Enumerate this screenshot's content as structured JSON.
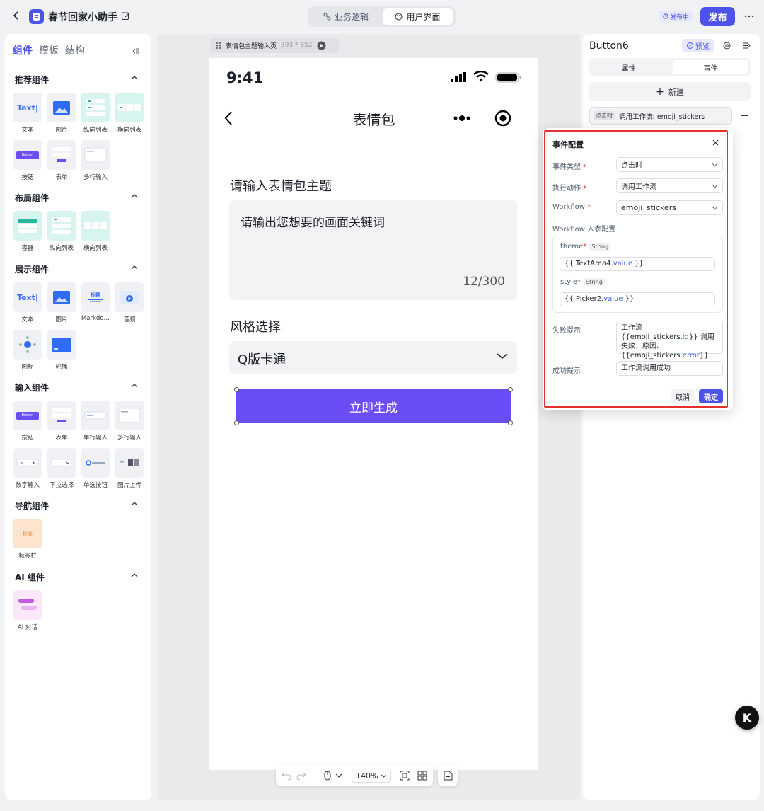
{
  "header": {
    "back_icon": "chevron-left-icon",
    "app_icon": "doc-icon",
    "app_name": "春节回家小助手",
    "edit_icon": "edit-icon",
    "tabs": [
      {
        "label": "业务逻辑",
        "icon": "flow-icon",
        "active": false
      },
      {
        "label": "用户界面",
        "icon": "palette-icon",
        "active": true
      }
    ],
    "publish_status": "发布中",
    "publish_label": "发布",
    "more_icon": "more-icon"
  },
  "left_panel": {
    "tabs": [
      "组件",
      "模板",
      "结构"
    ],
    "active_tab": "组件",
    "sections": [
      {
        "title": "推荐组件",
        "items": [
          "文本",
          "图片",
          "纵向列表",
          "横向列表",
          "按钮",
          "表单",
          "多行输入"
        ]
      },
      {
        "title": "布局组件",
        "items": [
          "容器",
          "纵向列表",
          "横向列表"
        ]
      },
      {
        "title": "展示组件",
        "items": [
          "文本",
          "图片",
          "Markdo…",
          "音频",
          "图标",
          "轮播"
        ]
      },
      {
        "title": "输入组件",
        "items": [
          "按钮",
          "表单",
          "单行输入",
          "多行输入",
          "数字输入",
          "下拉选择",
          "单选按钮",
          "图片上传"
        ]
      },
      {
        "title": "导航组件",
        "items": [
          "标签栏"
        ]
      },
      {
        "title": "AI 组件",
        "items": [
          "AI 对话"
        ]
      }
    ],
    "thumb_text": {
      "text": "Text",
      "button": "Button",
      "markdown": "标题",
      "tab": "标签"
    }
  },
  "canvas": {
    "page_label": "表情包主题输入页",
    "page_size": "393 * 852",
    "phone": {
      "time": "9:41",
      "title": "表情包",
      "theme_label": "请输入表情包主题",
      "theme_placeholder": "请输出您想要的画面关键词",
      "counter": "12/300",
      "style_label": "风格选择",
      "style_value": "Q版卡通",
      "button_label": "立即生成"
    },
    "zoom": "140%"
  },
  "right_panel": {
    "component_name": "Button6",
    "preview_label": "预览",
    "tabs": [
      "属性",
      "事件"
    ],
    "active_tab": "事件",
    "new_label": "新建",
    "event_tag": "点击时",
    "event_desc": "调用工作流: emoji_stickers"
  },
  "popup": {
    "title": "事件配置",
    "event_type_label": "事件类型",
    "event_type_value": "点击时",
    "action_label": "执行动作",
    "action_value": "调用工作流",
    "workflow_label": "Workflow",
    "workflow_value": "emoji_stickers",
    "params_label": "Workflow 入参配置",
    "params": [
      {
        "name": "theme",
        "type": "String",
        "prefix": "{{ TextArea4.",
        "key": "value",
        "suffix": " }}"
      },
      {
        "name": "style",
        "type": "String",
        "prefix": "{{ Picker2.",
        "key": "value",
        "suffix": " }}"
      }
    ],
    "fail_label": "失败提示",
    "fail_value_1": "工作流 {{emoji_stickers.",
    "fail_value_id": "id",
    "fail_value_2": "}} 调用失败，原因: {{emoji_stickers.",
    "fail_value_err": "error",
    "fail_value_3": "}}",
    "success_label": "成功提示",
    "success_value": "工作流调用成功",
    "cancel_label": "取消",
    "confirm_label": "确定"
  },
  "colors": {
    "accent": "#4d53e8",
    "button": "#6a4df5",
    "highlight": "#e3312d"
  }
}
